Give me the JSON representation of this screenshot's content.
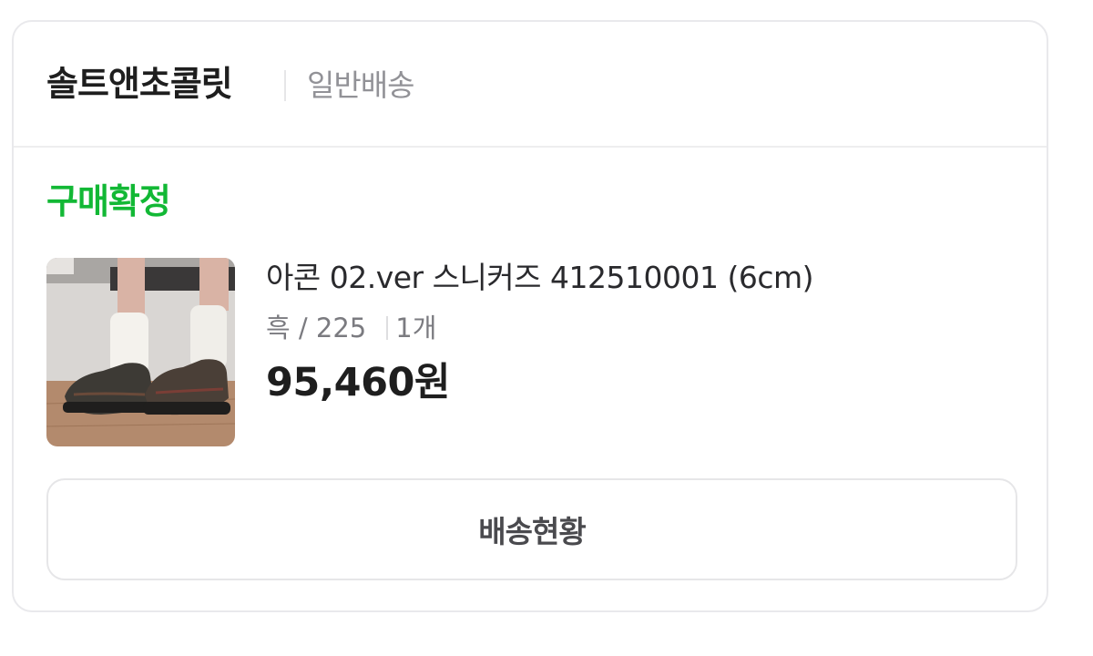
{
  "order": {
    "store_name": "솔트앤초콜릿",
    "shipping_type": "일반배송",
    "status": "구매확정",
    "status_color": "#12b835",
    "product": {
      "name": "아콘 02.ver 스니커즈 412510001 (6cm)",
      "option": "흑 / 225",
      "quantity": "1개",
      "price": "95,460원",
      "thumbnail_icon": "product-photo-sneakers"
    },
    "tracking_button_label": "배송현황"
  }
}
